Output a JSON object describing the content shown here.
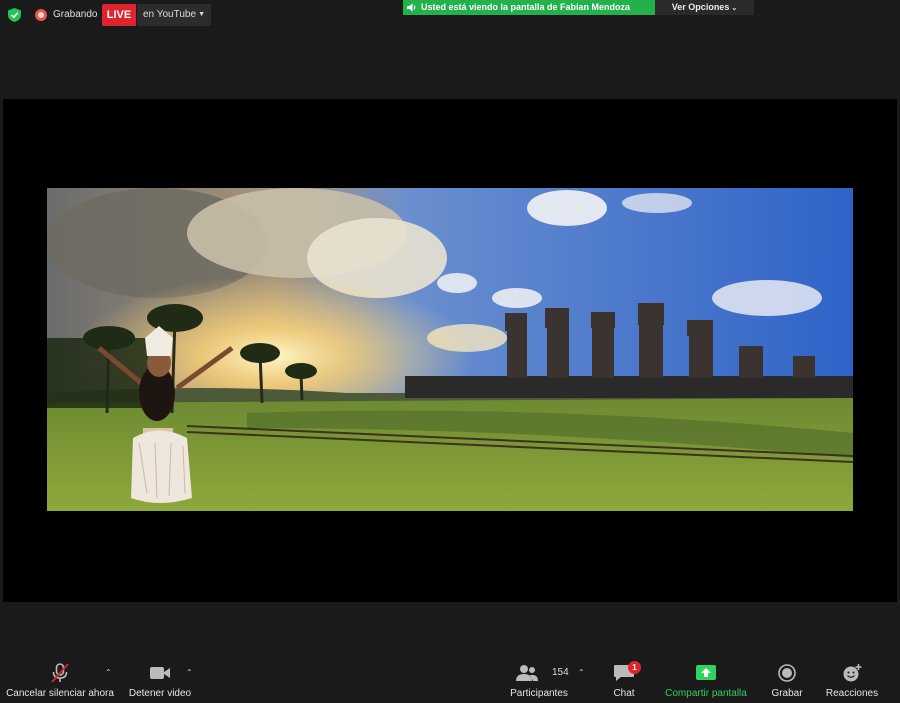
{
  "top_bar": {
    "recording_label": "Grabando",
    "live_badge": "LIVE",
    "live_target": "en YouTube",
    "share_banner": "Usted está viendo la pantalla de Fabian Mendoza",
    "view_options": "Ver Opciones"
  },
  "toolbar": {
    "unmute_label": "Cancelar silenciar ahora",
    "stop_video_label": "Detener video",
    "participants_label": "Participantes",
    "participants_count": "154",
    "chat_label": "Chat",
    "chat_badge": "1",
    "share_screen_label": "Compartir pantalla",
    "record_label": "Grabar",
    "reactions_label": "Reacciones"
  },
  "colors": {
    "background": "#1a1a1a",
    "live_red": "#e0242f",
    "share_green": "#22b14c",
    "share_label_green": "#2fd35f"
  },
  "icons": {
    "security": "shield-check-icon",
    "recording": "record-dot-icon",
    "microphone": "mic-muted-icon",
    "video": "video-camera-icon",
    "participants": "people-icon",
    "chat": "chat-bubble-icon",
    "share": "share-screen-up-arrow-icon",
    "record": "record-circle-icon",
    "reactions": "smiley-plus-icon"
  }
}
